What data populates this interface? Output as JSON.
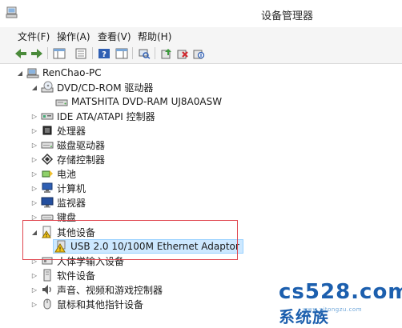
{
  "window": {
    "title": "设备管理器"
  },
  "menu": [
    {
      "label": "文件(F)"
    },
    {
      "label": "操作(A)"
    },
    {
      "label": "查看(V)"
    },
    {
      "label": "帮助(H)"
    }
  ],
  "toolbar_icons": [
    "back-arrow-icon",
    "forward-arrow-icon",
    "show-hide-console-tree-icon",
    "properties-icon",
    "help-icon",
    "action-pane-icon",
    "scan-hardware-icon",
    "update-driver-icon",
    "uninstall-device-icon",
    "disable-device-icon"
  ],
  "tree": {
    "root": "RenChao-PC",
    "dvd_category": "DVD/CD-ROM 驱动器",
    "dvd_device": "MATSHITA DVD-RAM UJ8A0ASW",
    "categories": [
      {
        "label": "IDE ATA/ATAPI 控制器",
        "icon": "ide-controller-icon"
      },
      {
        "label": "处理器",
        "icon": "processor-icon"
      },
      {
        "label": "磁盘驱动器",
        "icon": "disk-drive-icon"
      },
      {
        "label": "存储控制器",
        "icon": "storage-controller-icon"
      },
      {
        "label": "电池",
        "icon": "battery-icon"
      },
      {
        "label": "计算机",
        "icon": "computer-icon"
      },
      {
        "label": "监视器",
        "icon": "monitor-icon"
      },
      {
        "label": "键盘",
        "icon": "keyboard-icon"
      }
    ],
    "other_devices": "其他设备",
    "selected_device": "USB 2.0 10/100M Ethernet Adaptor",
    "categories_after": [
      {
        "label": "人体学输入设备",
        "icon": "hid-icon"
      },
      {
        "label": "软件设备",
        "icon": "software-device-icon"
      },
      {
        "label": "声音、视频和游戏控制器",
        "icon": "sound-icon"
      },
      {
        "label": "鼠标和其他指针设备",
        "icon": "mouse-icon"
      }
    ]
  },
  "watermark": {
    "text": "cs528.com",
    "suffix": "系统族",
    "small": "www.xitongzu.com"
  },
  "colors": {
    "highlight_border": "#e0464f",
    "selection_bg": "#cde8ff",
    "warning": "#f5c518"
  }
}
